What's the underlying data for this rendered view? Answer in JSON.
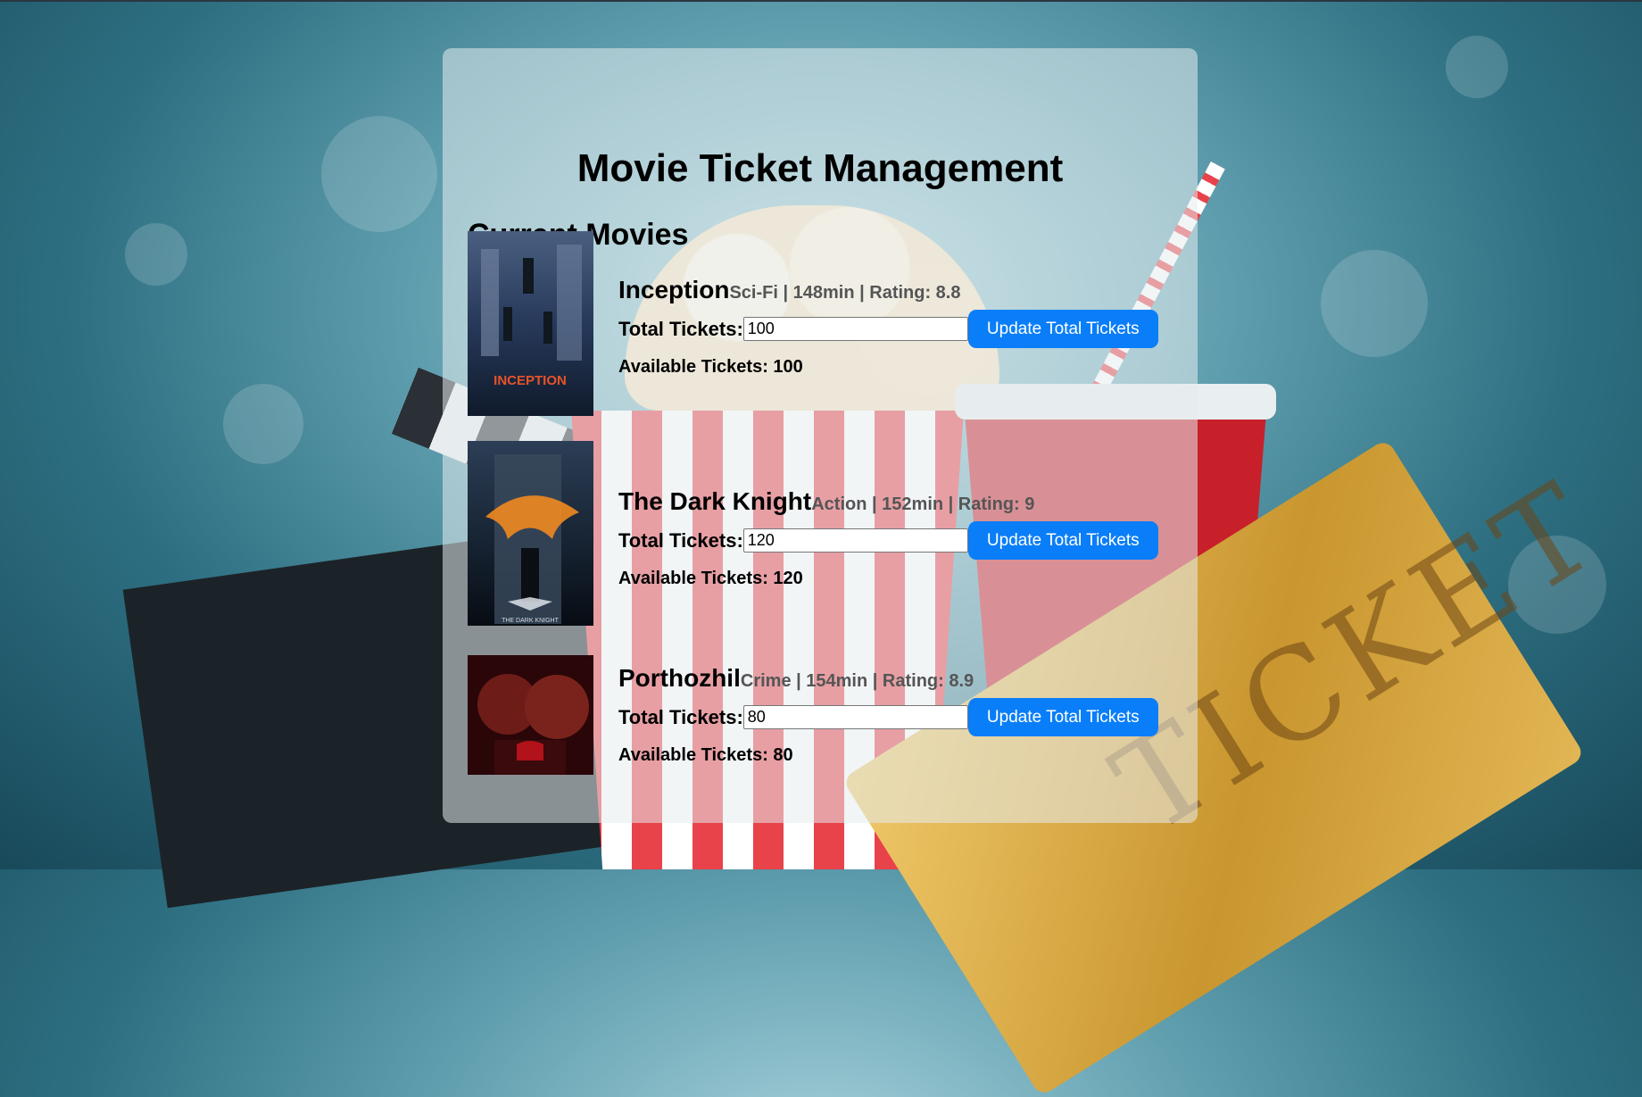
{
  "page": {
    "title": "Movie Ticket Management",
    "section_title": "Current Movies"
  },
  "movies": [
    {
      "title": "Inception",
      "meta": "Sci-Fi | 148min | Rating: 8.8",
      "tickets_label": "Total Tickets:",
      "total_tickets_value": "100",
      "update_label": "Update Total Tickets",
      "available_label": "Available Tickets: 100",
      "poster_caption": "INCEPTION"
    },
    {
      "title": "The Dark Knight",
      "meta": "Action | 152min | Rating: 9",
      "tickets_label": "Total Tickets:",
      "total_tickets_value": "120",
      "update_label": "Update Total Tickets",
      "available_label": "Available Tickets: 120",
      "poster_caption": "THE DARK KNIGHT"
    },
    {
      "title": "Porthozhil",
      "meta": "Crime | 154min | Rating: 8.9",
      "tickets_label": "Total Tickets:",
      "total_tickets_value": "80",
      "update_label": "Update Total Tickets",
      "available_label": "Available Tickets: 80",
      "poster_caption": ""
    }
  ],
  "background": {
    "ticket_text": "TICKET"
  },
  "colors": {
    "button": "#0a7ef8",
    "panel": "rgba(230,236,238,0.55)"
  }
}
